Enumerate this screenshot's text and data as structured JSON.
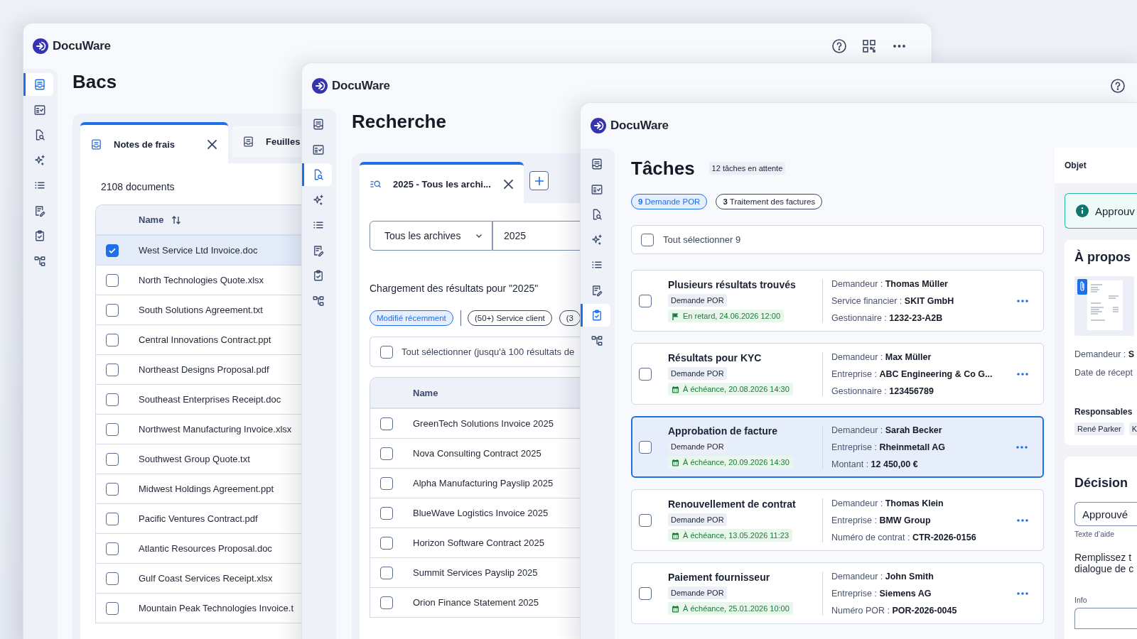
{
  "bins_window": {
    "logo": "DocuWare",
    "title": "Bacs",
    "sidebar": [
      {
        "selected": true
      },
      {
        "selected": false
      },
      {
        "selected": false
      },
      {
        "selected": false
      },
      {
        "selected": false
      },
      {
        "selected": false
      },
      {
        "selected": false
      },
      {
        "selected": false
      }
    ],
    "tabs": [
      {
        "label": "Notes de frais",
        "selected": true
      },
      {
        "label": "Feuilles",
        "selected": false
      }
    ],
    "count": "2108 documents",
    "table": {
      "columns": [
        "Name"
      ],
      "rows": [
        {
          "name": "West Service Ltd Invoice.doc",
          "checked": true
        },
        {
          "name": "North Technologies Quote.xlsx",
          "checked": false
        },
        {
          "name": "South Solutions Agreement.txt",
          "checked": false
        },
        {
          "name": "Central Innovations Contract.ppt",
          "checked": false
        },
        {
          "name": "Northeast Designs Proposal.pdf",
          "checked": false
        },
        {
          "name": "Southeast Enterprises Receipt.doc",
          "checked": false
        },
        {
          "name": "Northwest Manufacturing Invoice.xlsx",
          "checked": false
        },
        {
          "name": "Southwest Group Quote.txt",
          "checked": false
        },
        {
          "name": "Midwest Holdings Agreement.ppt",
          "checked": false
        },
        {
          "name": "Pacific Ventures Contract.pdf",
          "checked": false
        },
        {
          "name": "Atlantic Resources Proposal.doc",
          "checked": false
        },
        {
          "name": "Gulf Coast Services Receipt.xlsx",
          "checked": false
        },
        {
          "name": "Mountain Peak Technologies Invoice.t",
          "checked": false
        }
      ]
    }
  },
  "search_window": {
    "logo": "DocuWare",
    "title": "Recherche",
    "sidebar": [
      {
        "selected": false
      },
      {
        "selected": false
      },
      {
        "selected": true
      },
      {
        "selected": false
      },
      {
        "selected": false
      },
      {
        "selected": false
      },
      {
        "selected": false
      },
      {
        "selected": false
      }
    ],
    "tabs": [
      {
        "label": "2025 - Tous les archi...",
        "selected": true
      }
    ],
    "scope": "Tous les archives",
    "query": "2025",
    "status": "Chargement des résultats pour \"2025\"",
    "filters": [
      {
        "label": "Modifié récemment",
        "selected": true
      },
      {
        "label": "(50+) Service client",
        "selected": false
      },
      {
        "label": "(3",
        "selected": false
      }
    ],
    "select_all": {
      "label": "Tout sélectionner (jusqu'à 100 résultats de",
      "checked": false
    },
    "table": {
      "columns": [
        "Name"
      ],
      "rows": [
        {
          "name": "GreenTech Solutions Invoice 2025",
          "checked": false
        },
        {
          "name": "Nova Consulting Contract 2025",
          "checked": false
        },
        {
          "name": "Alpha Manufacturing Payslip 2025",
          "checked": false
        },
        {
          "name": "BlueWave Logistics Invoice 2025",
          "checked": false
        },
        {
          "name": "Horizon Software Contract 2025",
          "checked": false
        },
        {
          "name": "Summit Services Payslip 2025",
          "checked": false
        },
        {
          "name": "Orion Finance Statement 2025",
          "checked": false
        }
      ]
    }
  },
  "tasks_window": {
    "logo": "DocuWare",
    "title": "Tâches",
    "pending": "12 tâches en attente",
    "sidebar": [
      {
        "selected": false
      },
      {
        "selected": false
      },
      {
        "selected": false
      },
      {
        "selected": false
      },
      {
        "selected": false
      },
      {
        "selected": false
      },
      {
        "selected": true
      },
      {
        "selected": false
      }
    ],
    "filters": [
      {
        "label": "**9** Demande POR",
        "selected": true
      },
      {
        "label": "**3** Traitement des factures",
        "selected": false
      }
    ],
    "select_all": {
      "label": "Tout sélectionner 9",
      "checked": false
    },
    "tasks": [
      {
        "title": "Plusieurs résultats trouvés",
        "tag": "Demande POR",
        "due": {
          "kind": "overdue",
          "text": "En retard, 24.06.2026 12:00"
        },
        "fields": [
          "Demandeur : **Thomas Müller**",
          "Service financier : **SKIT GmbH**",
          "Gestionnaire : **1232-23-A2B**"
        ],
        "checked": false,
        "selected": false
      },
      {
        "title": "Résultats pour KYC",
        "tag": "Demande POR",
        "due": {
          "kind": "due",
          "text": "À échéance, 20.08.2026 14:30"
        },
        "fields": [
          "Demandeur : **Max Müller**",
          "Entreprise : **ABC Engineering & Co G...**",
          "Gestionnaire : **123456789**"
        ],
        "checked": false,
        "selected": false
      },
      {
        "title": "Approbation de facture",
        "tag": "Demande POR",
        "due": {
          "kind": "due",
          "text": "À échéance, 20.09.2026 14:30"
        },
        "fields": [
          "Demandeur : **Sarah Becker**",
          "Entreprise : **Rheinmetall AG**",
          "Montant : **12 450,00 €**"
        ],
        "checked": false,
        "selected": true
      },
      {
        "title": "Renouvellement de contrat",
        "tag": "Demande POR",
        "due": {
          "kind": "due",
          "text": "À échéance, 13.05.2026 11:23"
        },
        "fields": [
          "Demandeur : **Thomas Klein**",
          "Entreprise : **BMW Group**",
          "Numéro de contrat : **CTR-2026-0156**"
        ],
        "checked": false,
        "selected": false
      },
      {
        "title": "Paiement fournisseur",
        "tag": "Demande POR",
        "due": {
          "kind": "due",
          "text": "À échéance, 25.01.2026 10:00"
        },
        "fields": [
          "Demandeur : **John Smith**",
          "Entreprise : **Siemens AG**",
          "Numéro POR : **POR-2026-0045**"
        ],
        "checked": false,
        "selected": false
      }
    ],
    "detail": {
      "tab": "Objet",
      "banner": "Approuv",
      "about_title": "À propos",
      "about_fields": [
        "Demandeur : **S**",
        "Date de récept"
      ],
      "responsibles_title": "Responsables",
      "responsibles": [
        "René Parker",
        "K"
      ],
      "decision_title": "Décision",
      "decision_value": "Approuvé",
      "helper": "Texte d’aide",
      "instructions": [
        "Remplissez t",
        "dialogue de c"
      ],
      "info_label": "Info"
    }
  }
}
